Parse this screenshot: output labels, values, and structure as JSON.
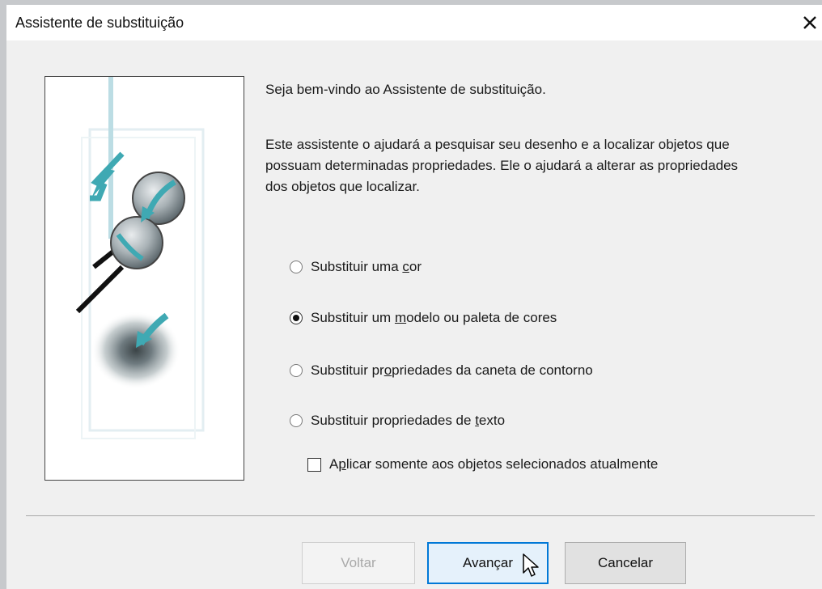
{
  "window": {
    "title": "Assistente de substituição",
    "close_icon": "close-icon"
  },
  "content": {
    "welcome": "Seja bem-vindo ao Assistente de substituição.",
    "description": "Este assistente o ajudará a pesquisar seu desenho e a localizar objetos que possuam determinadas propriedades. Ele o ajudará a alterar as propriedades dos objetos que localizar."
  },
  "options": [
    {
      "pre": "Substituir uma ",
      "key": "c",
      "post": "or",
      "checked": false
    },
    {
      "pre": "Substituir um ",
      "key": "m",
      "post": "odelo ou paleta de cores",
      "checked": true
    },
    {
      "pre": "Substituir pr",
      "key": "o",
      "post": "priedades da caneta de contorno",
      "checked": false
    },
    {
      "pre": "Substituir propriedades de ",
      "key": "t",
      "post": "exto",
      "checked": false
    }
  ],
  "checkbox": {
    "pre": "A",
    "key": "p",
    "post": "licar somente aos objetos selecionados atualmente",
    "checked": false
  },
  "buttons": {
    "back": "Voltar",
    "next": "Avançar",
    "cancel": "Cancelar"
  },
  "colors": {
    "accent": "#0078d7",
    "arrow_teal": "#3fa9b3"
  }
}
